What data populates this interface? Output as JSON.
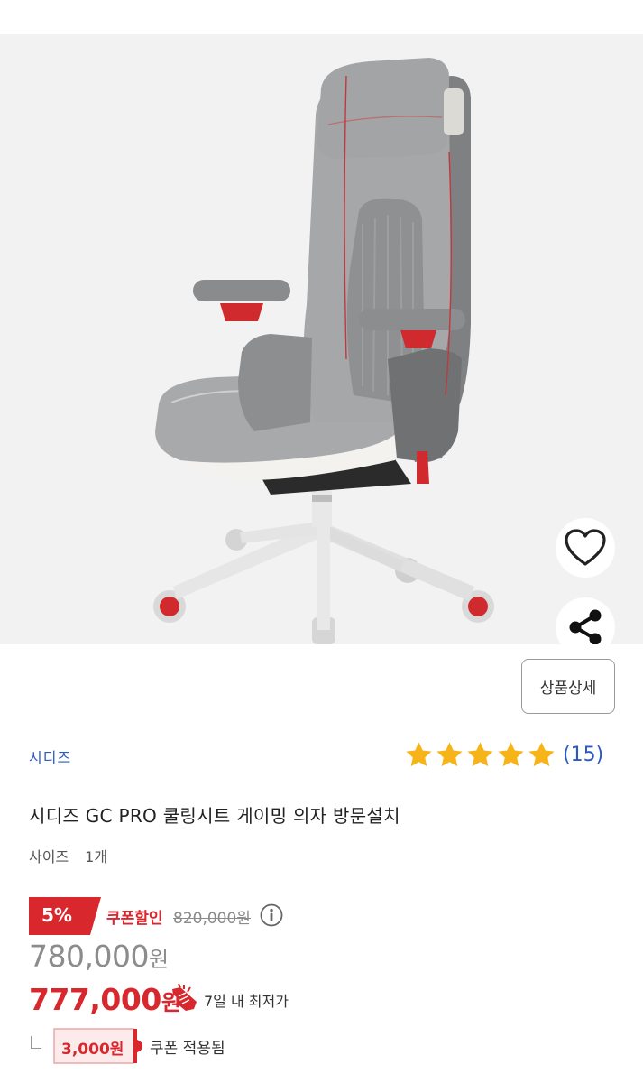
{
  "product": {
    "brand": "시디즈",
    "title": "시디즈 GC PRO 쿨링시트 게이밍 의자 방문설치",
    "option_label": "사이즈",
    "option_value": "1개"
  },
  "actions": {
    "detail_button": "상품상세",
    "wishlist_icon": "heart-outline-icon",
    "share_icon": "share-icon"
  },
  "rating": {
    "stars": 5,
    "count_text": "(15)",
    "star_color": "#f6b418"
  },
  "pricing": {
    "discount_rate": "5%",
    "coupon_discount_label": "쿠폰할인",
    "original_price": "820,000원",
    "sale_price_number": "780,000",
    "final_price_number": "777,000",
    "won": "원",
    "lowest_in_7_days": "7일 내 최저가",
    "coupon_amount": "3,000원",
    "coupon_applied_label": "쿠폰 적용됨",
    "accent_color": "#d8282e",
    "link_color": "#2a59c7"
  }
}
